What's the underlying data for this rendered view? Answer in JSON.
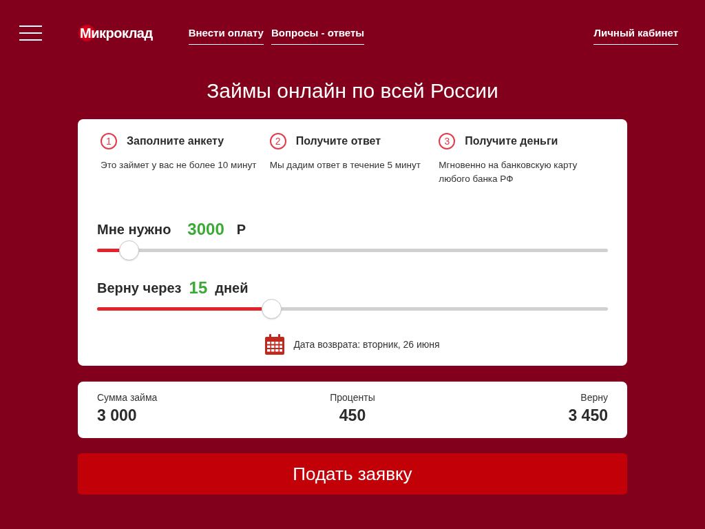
{
  "header": {
    "logo": "Микроклад",
    "nav_links": [
      "Внести оплату",
      "Вопросы - ответы"
    ],
    "account_link": "Личный кабинет"
  },
  "title": "Займы онлайн по всей России",
  "steps": [
    {
      "number": "1",
      "title": "Заполните анкету",
      "description": "Это займет у вас не более 10 минут"
    },
    {
      "number": "2",
      "title": "Получите ответ",
      "description": "Мы дадим ответ в течение 5 минут"
    },
    {
      "number": "3",
      "title": "Получите деньги",
      "description": "Мгновенно на банковскую карту любого банка РФ"
    }
  ],
  "sliders": [
    {
      "label": "Мне нужно",
      "value": "3000",
      "unit": "Р",
      "level": 0.063
    },
    {
      "label": "Верну через",
      "value": "15",
      "unit": "дней",
      "level": 0.342
    }
  ],
  "return_date": "Дата возврата: вторник, 26 июня",
  "summary": [
    {
      "label": "Сумма займа",
      "value": "3 000"
    },
    {
      "label": "Проценты",
      "value": "450"
    },
    {
      "label": "Верну",
      "value": "3 450"
    }
  ],
  "submit_button": "Подать заявку"
}
